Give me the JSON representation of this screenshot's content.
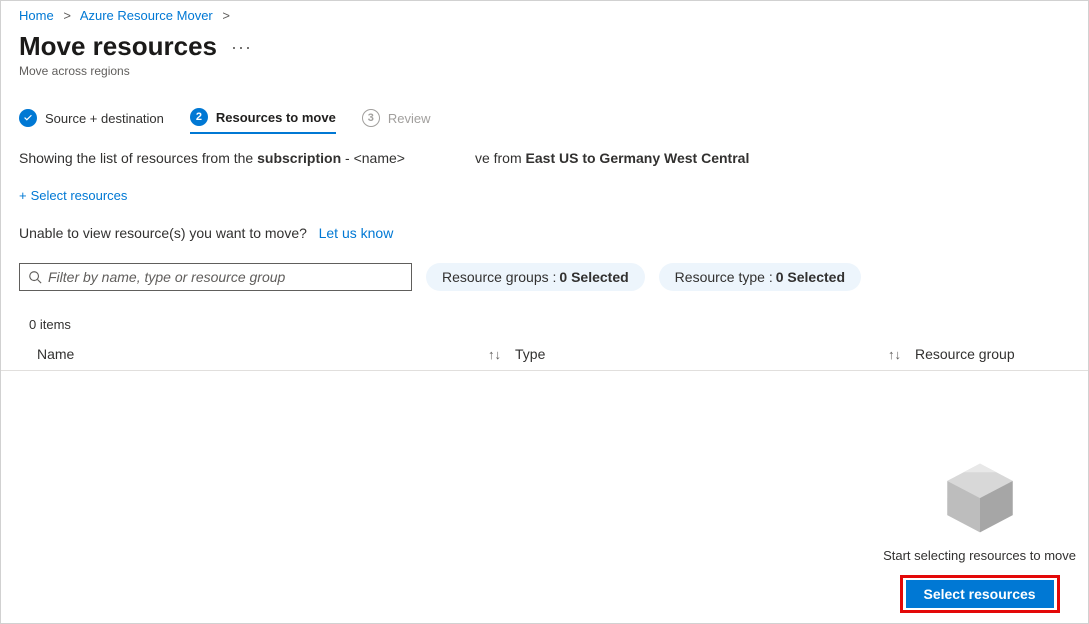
{
  "breadcrumb": {
    "home": "Home",
    "service": "Azure Resource Mover"
  },
  "title": "Move resources",
  "subtitle": "Move across regions",
  "steps": {
    "s1": "Source + destination",
    "s2": "Resources to move",
    "s3": "Review",
    "num2": "2",
    "num3": "3"
  },
  "context": {
    "prefix": "Showing the list of resources from the ",
    "sub_lbl": "subscription",
    "dash": " - ",
    "name_ph": "<name>",
    "move_frag": "ve from ",
    "regions": "East US to Germany West Central"
  },
  "links": {
    "select_resources": "Select resources",
    "let_us_know": "Let us know"
  },
  "help": "Unable to view resource(s) you want to move?",
  "filter": {
    "placeholder": "Filter by name, type or resource group"
  },
  "pills": {
    "rg_label": "Resource groups :",
    "rg_val": "0 Selected",
    "rt_label": "Resource type :",
    "rt_val": "0 Selected"
  },
  "count": "0 items",
  "columns": {
    "name": "Name",
    "type": "Type",
    "rg": "Resource group"
  },
  "empty": {
    "msg": "Start selecting resources to move",
    "btn": "Select resources"
  }
}
